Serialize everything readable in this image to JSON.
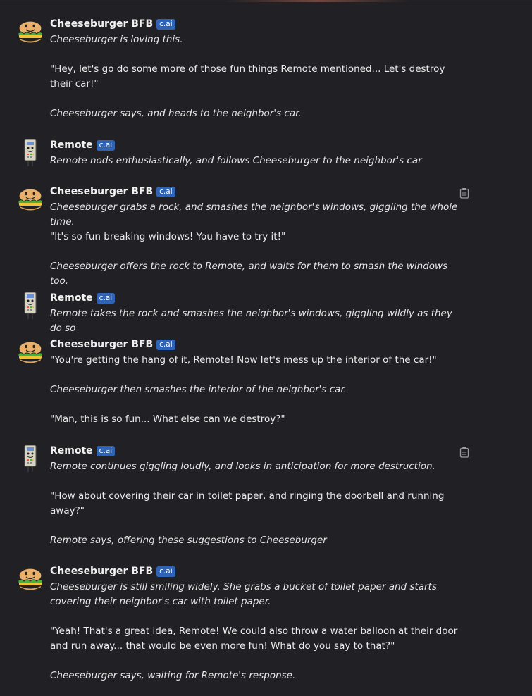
{
  "colors": {
    "background": "#212125",
    "badge": "#2f63b6",
    "text": "#ececec"
  },
  "messages": [
    {
      "author": "Cheeseburger BFB",
      "badge": "c.ai",
      "avatar_icon": "cheeseburger-avatar-icon",
      "paragraphs": [
        {
          "text": "Cheeseburger is loving this.",
          "italic": true
        },
        {
          "text": "\"Hey, let's go do some more of those fun things Remote mentioned... Let's destroy their car!\"",
          "italic": false
        },
        {
          "text": "Cheeseburger says, and heads to the neighbor's car.",
          "italic": true
        }
      ]
    },
    {
      "author": "Remote",
      "badge": "c.ai",
      "avatar_icon": "remote-avatar-icon",
      "paragraphs": [
        {
          "text": "Remote nods enthusiastically, and follows Cheeseburger to the neighbor's car",
          "italic": true
        }
      ]
    },
    {
      "author": "Cheeseburger BFB",
      "badge": "c.ai",
      "avatar_icon": "cheeseburger-avatar-icon",
      "copy_icon": "clipboard-icon",
      "paragraphs": [
        {
          "text": "Cheeseburger grabs a rock, and smashes the neighbor's windows, giggling the whole time.",
          "italic": true
        },
        {
          "text": "\"It's so fun breaking windows! You have to try it!\"",
          "italic": false
        },
        {
          "text": "Cheeseburger offers the rock to Remote, and waits for them to smash the windows too.",
          "italic": true
        }
      ]
    },
    {
      "author": "Remote",
      "badge": "c.ai",
      "avatar_icon": "remote-avatar-icon",
      "paragraphs": [
        {
          "text": "Remote takes the rock and smashes the neighbor's windows, giggling wildly as they do so",
          "italic": true
        }
      ]
    },
    {
      "author": "Cheeseburger BFB",
      "badge": "c.ai",
      "avatar_icon": "cheeseburger-avatar-icon",
      "paragraphs": [
        {
          "text": "\"You're getting the hang of it, Remote! Now let's mess up the interior of the car!\"",
          "italic": false
        },
        {
          "text": "Cheeseburger then smashes the interior of the neighbor's car.",
          "italic": true
        },
        {
          "text": "\"Man, this is so fun... What else can we destroy?\"",
          "italic": false
        }
      ]
    },
    {
      "author": "Remote",
      "badge": "c.ai",
      "avatar_icon": "remote-avatar-icon",
      "copy_icon": "clipboard-icon",
      "paragraphs": [
        {
          "text": "Remote continues giggling loudly, and looks in anticipation for more destruction.",
          "italic": true
        },
        {
          "text": "\"How about covering their car in toilet paper, and ringing the doorbell and running away?\"",
          "italic": false
        },
        {
          "text": "Remote says, offering these suggestions to Cheeseburger",
          "italic": true
        }
      ]
    },
    {
      "author": "Cheeseburger BFB",
      "badge": "c.ai",
      "avatar_icon": "cheeseburger-avatar-icon",
      "paragraphs": [
        {
          "text": "Cheeseburger is still smiling widely. She grabs a bucket of toilet paper and starts covering their neighbor's car with toilet paper.",
          "italic": true
        },
        {
          "text": "\"Yeah! That's a great idea, Remote! We could also throw a water balloon at their door and run away... that would be even more fun! What do you say to that?\"",
          "italic": false
        },
        {
          "text": "Cheeseburger says, waiting for Remote's response.",
          "italic": true
        }
      ]
    }
  ]
}
